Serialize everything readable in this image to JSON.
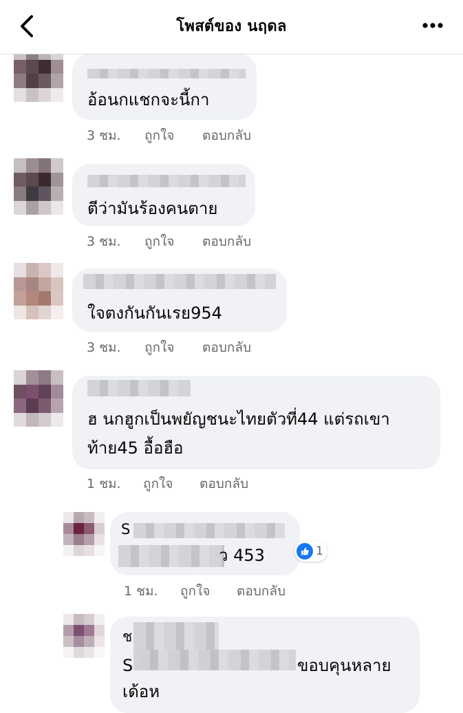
{
  "header": {
    "title": "โพสต์ของ นฤดล",
    "back_icon": "chevron-left-icon",
    "more_icon": "more-dots-icon"
  },
  "actions": {
    "like": "ถูกใจ",
    "reply": "ตอบกลับ"
  },
  "comments": [
    {
      "text": "อ้อนกแชกจะนี้กา",
      "time": "3 ชม."
    },
    {
      "text": "ตีว่ามันร้องคนตาย",
      "time": "3 ชม."
    },
    {
      "text": "ใจตงกันกันเรย954",
      "time": "3 ชม."
    },
    {
      "text_line1": "ฮ นกฮูกเป็นพยัญชนะไทยตัวที่44 แต่รถเขา",
      "text_line2": "ท้าย45 อื้อฮือ",
      "time": "1 ชม."
    }
  ],
  "replies": [
    {
      "name_initial": "S",
      "text": "ว 453",
      "time": "1 ชม.",
      "reaction_count": "1"
    },
    {
      "name_initial": "ช",
      "text_initial": "S",
      "text_tail": "ขอบคุนหลาย",
      "text_line2": "เด้อห"
    }
  ],
  "colors": {
    "accent": "#1877f2",
    "bubble": "#f0f2f5",
    "meta": "#65676b"
  }
}
